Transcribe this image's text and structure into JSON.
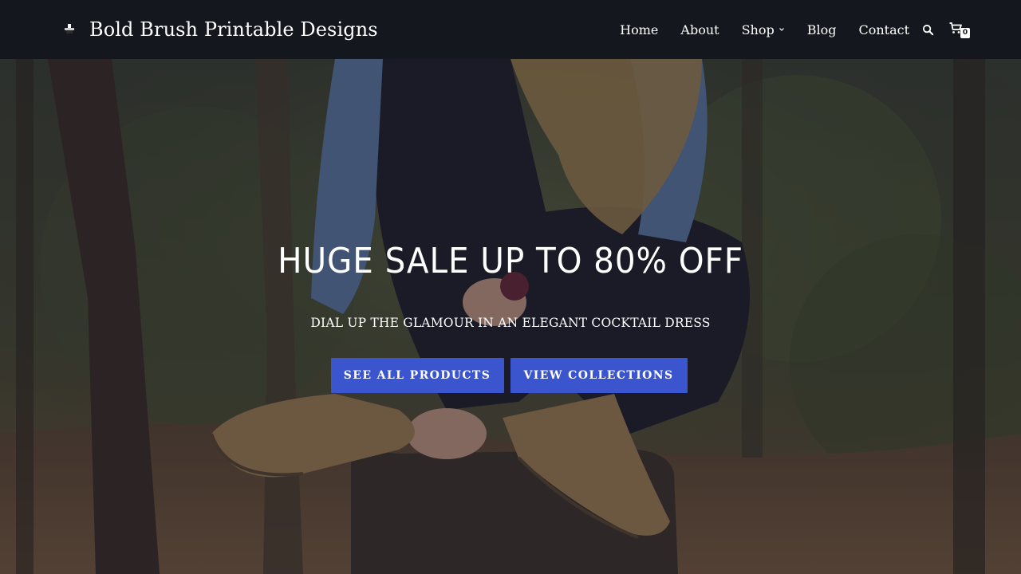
{
  "header": {
    "site_title": "Bold Brush Printable Designs",
    "logo_icon": "site-logo-icon",
    "nav": [
      {
        "label": "Home"
      },
      {
        "label": "About"
      },
      {
        "label": "Shop",
        "has_dropdown": true
      },
      {
        "label": "Blog"
      },
      {
        "label": "Contact"
      }
    ],
    "search_icon": "search-icon",
    "cart_icon": "cart-icon",
    "cart_count": "0",
    "background_color": "#14171e"
  },
  "hero": {
    "title": "HUGE SALE UP TO 80% OFF",
    "subtitle": "DIAL UP THE GLAMOUR IN AN ELEGANT COCKTAIL DRESS",
    "buttons": [
      {
        "label": "SEE ALL PRODUCTS"
      },
      {
        "label": "VIEW COLLECTIONS"
      }
    ],
    "button_color": "#3b55cf"
  }
}
